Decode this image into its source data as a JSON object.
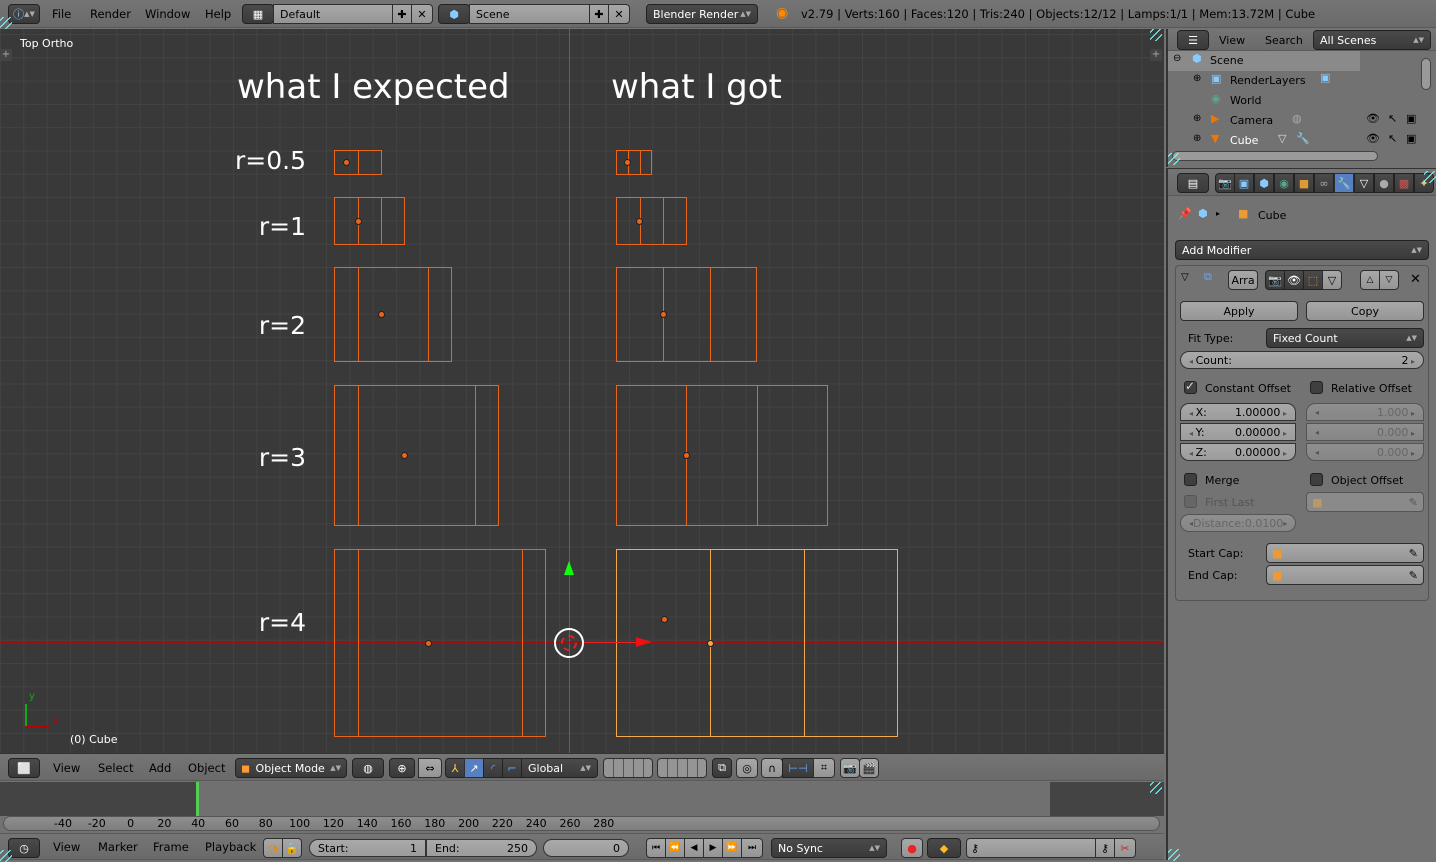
{
  "topbar": {
    "menus": [
      "File",
      "Render",
      "Window",
      "Help"
    ],
    "layout": "Default",
    "scene": "Scene",
    "engine": "Blender Render",
    "stats": "v2.79 | Verts:160 | Faces:120 | Tris:240 | Objects:12/12 | Lamps:1/1 | Mem:13.72M | Cube"
  },
  "viewport": {
    "view_name": "Top Ortho",
    "object_info": "(0) Cube",
    "axis_x": "x",
    "axis_y": "y",
    "heading_left": "what I expected",
    "heading_right": "what I got",
    "rows": [
      {
        "label": "r=0.5"
      },
      {
        "label": "r=1"
      },
      {
        "label": "r=2"
      },
      {
        "label": "r=3"
      },
      {
        "label": "r=4"
      }
    ],
    "colors": {
      "wire": "#e8651a",
      "active": "#f5a94a",
      "x_axis": "#c00000",
      "y_axis": "#2a8a2a"
    }
  },
  "view3d_header": {
    "menus": [
      "View",
      "Select",
      "Add",
      "Object"
    ],
    "mode": "Object Mode",
    "orientation": "Global"
  },
  "timeline": {
    "ticks": [
      "-40",
      "-20",
      "0",
      "20",
      "40",
      "60",
      "80",
      "100",
      "120",
      "140",
      "160",
      "180",
      "200",
      "220",
      "240",
      "260",
      "280"
    ],
    "menus": [
      "View",
      "Marker",
      "Frame",
      "Playback"
    ],
    "start_label": "Start:",
    "start_value": "1",
    "end_label": "End:",
    "end_value": "250",
    "current_frame": "0",
    "sync": "No Sync"
  },
  "outliner": {
    "menus": [
      "View",
      "Search"
    ],
    "filter": "All Scenes",
    "items": [
      {
        "label": "Scene"
      },
      {
        "label": "RenderLayers"
      },
      {
        "label": "World"
      },
      {
        "label": "Camera"
      },
      {
        "label": "Cube"
      }
    ]
  },
  "properties": {
    "context_object": "Cube",
    "add_modifier": "Add Modifier",
    "modifier_name": "Arra",
    "apply": "Apply",
    "copy": "Copy",
    "fit_type_label": "Fit Type:",
    "fit_type": "Fixed Count",
    "count_label": "Count:",
    "count": "2",
    "constant_offset": "Constant Offset",
    "relative_offset": "Relative Offset",
    "constant": [
      {
        "axis": "X:",
        "value": "1.00000"
      },
      {
        "axis": "Y:",
        "value": "0.00000"
      },
      {
        "axis": "Z:",
        "value": "0.00000"
      }
    ],
    "relative": [
      "1.000",
      "0.000",
      "0.000"
    ],
    "merge": "Merge",
    "first_last": "First Last",
    "distance": "Distance:0.0100",
    "object_offset": "Object Offset",
    "start_cap": "Start Cap:",
    "end_cap": "End Cap:"
  }
}
